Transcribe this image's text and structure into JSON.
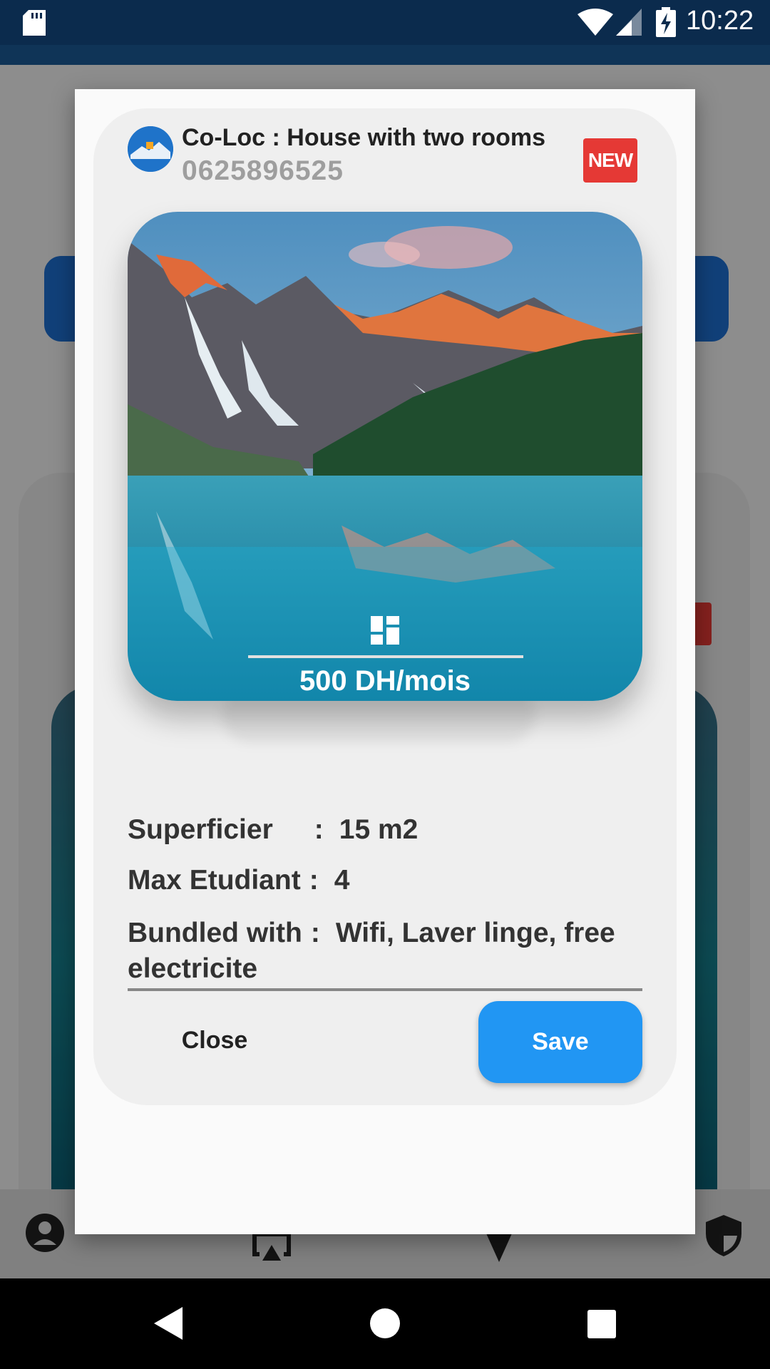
{
  "status_bar": {
    "time": "10:22"
  },
  "dialog": {
    "title": "Co-Loc : House with two rooms",
    "phone": "0625896525",
    "badge": "NEW",
    "price": "500 DH/mois",
    "details": [
      {
        "label": "Superficier",
        "sep": ":",
        "value": "15 m2"
      },
      {
        "label": "Max Etudiant",
        "sep": ":",
        "value": "4"
      },
      {
        "label": "Bundled with",
        "sep": ":",
        "value": "Wifi, Laver linge, free electricite"
      }
    ],
    "close_label": "Close",
    "save_label": "Save"
  },
  "colors": {
    "accent": "#2196f3",
    "badge": "#e53935",
    "status_bar": "#0b2b4d"
  }
}
